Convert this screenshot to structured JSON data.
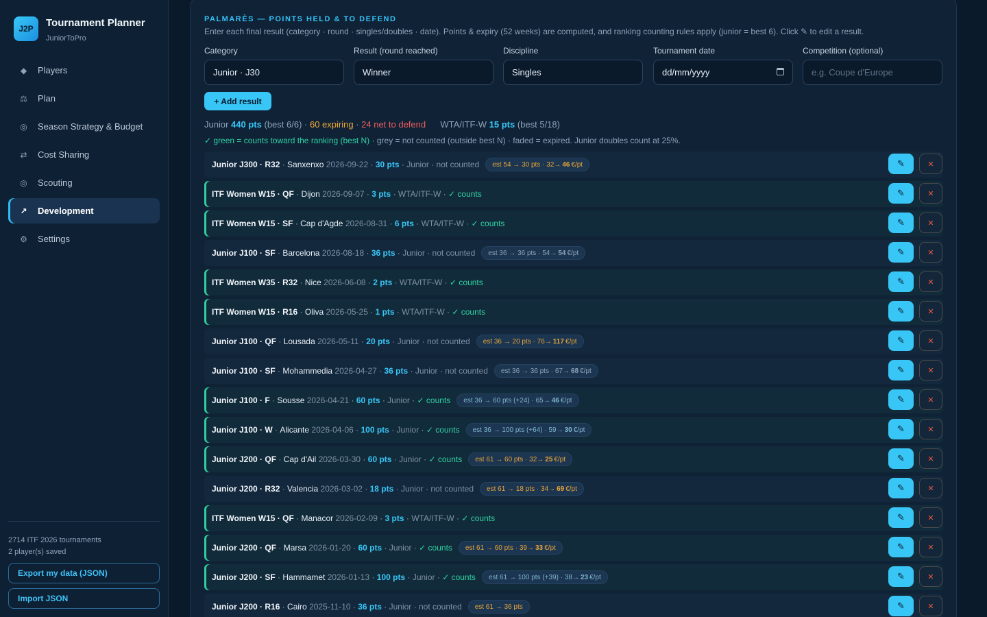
{
  "app": {
    "logo": "J2P",
    "title": "Tournament Planner",
    "subtitle": "JuniorToPro"
  },
  "nav": [
    {
      "icon": "◆",
      "icon_name": "diamond-icon",
      "label": "Players"
    },
    {
      "icon": "⚖",
      "icon_name": "scale-icon",
      "label": "Plan"
    },
    {
      "icon": "◎",
      "icon_name": "target-icon",
      "label": "Season Strategy & Budget"
    },
    {
      "icon": "⇄",
      "icon_name": "swap-arrows-icon",
      "label": "Cost Sharing"
    },
    {
      "icon": "◎",
      "icon_name": "target-icon",
      "label": "Scouting"
    },
    {
      "icon": "↗",
      "icon_name": "trend-arrow-icon",
      "label": "Development",
      "active": true
    },
    {
      "icon": "⚙",
      "icon_name": "gear-icon",
      "label": "Settings"
    }
  ],
  "sidebar_footer": {
    "stats_line1": "2714 ITF 2026 tournaments",
    "stats_line2": "2 player(s) saved",
    "export_label": "Export my data (JSON)",
    "import_label": "Import JSON"
  },
  "palmares": {
    "title": "PALMARÈS — POINTS HELD & TO DEFEND",
    "description": "Enter each final result (category · round · singles/doubles · date). Points & expiry (52 weeks) are computed, and ranking counting rules apply (junior = best 6). Click ✎ to edit a result.",
    "form": {
      "category_label": "Category",
      "category_value": "Junior · J30",
      "result_label": "Result (round reached)",
      "result_value": "Winner",
      "discipline_label": "Discipline",
      "discipline_value": "Singles",
      "date_label": "Tournament date",
      "date_placeholder": "dd/mm/yyyy",
      "competition_label": "Competition (optional)",
      "competition_placeholder": "e.g. Coupe d'Europe"
    },
    "add_button": "+ Add result",
    "summary": {
      "junior_prefix": "Junior",
      "junior_pts": "440 pts",
      "junior_best": "(best 6/6)",
      "expiring": "60 expiring",
      "net_defend": "24 net to defend",
      "wta_prefix": "WTA/ITF-W",
      "wta_pts": "15 pts",
      "wta_best": "(best 5/18)"
    },
    "legend": {
      "green": "✓ green = counts toward the ranking (best N)",
      "rest": "· grey = not counted (outside best N) · faded = expired. Junior doubles count at 25%."
    }
  },
  "results": [
    {
      "title": "Junior J300 · R32",
      "venue": "Sanxenxo",
      "date": "2026-09-22",
      "pts": "30 pts",
      "circuit": "Junior",
      "status": "not counted",
      "counts": false,
      "est_a": "est 54 → 30 pts · 32→",
      "est_b": "46",
      "est_c": "€/pt",
      "est_tone": "warn"
    },
    {
      "title": "ITF Women W15 · QF",
      "venue": "Dijon",
      "date": "2026-09-07",
      "pts": "3 pts",
      "circuit": "WTA/ITF-W",
      "status": "✓ counts",
      "counts": true
    },
    {
      "title": "ITF Women W15 · SF",
      "venue": "Cap d'Agde",
      "date": "2026-08-31",
      "pts": "6 pts",
      "circuit": "WTA/ITF-W",
      "status": "✓ counts",
      "counts": true
    },
    {
      "title": "Junior J100 · SF",
      "venue": "Barcelona",
      "date": "2026-08-18",
      "pts": "36 pts",
      "circuit": "Junior",
      "status": "not counted",
      "counts": false,
      "est_a": "est 36 → 36 pts · 54→",
      "est_b": "54",
      "est_c": "€/pt",
      "est_tone": ""
    },
    {
      "title": "ITF Women W35 · R32",
      "venue": "Nice",
      "date": "2026-06-08",
      "pts": "2 pts",
      "circuit": "WTA/ITF-W",
      "status": "✓ counts",
      "counts": true
    },
    {
      "title": "ITF Women W15 · R16",
      "venue": "Oliva",
      "date": "2026-05-25",
      "pts": "1 pts",
      "circuit": "WTA/ITF-W",
      "status": "✓ counts",
      "counts": true
    },
    {
      "title": "Junior J100 · QF",
      "venue": "Lousada",
      "date": "2026-05-11",
      "pts": "20 pts",
      "circuit": "Junior",
      "status": "not counted",
      "counts": false,
      "est_a": "est 36 → 20 pts · 76→",
      "est_b": "117",
      "est_c": "€/pt",
      "est_tone": "warn"
    },
    {
      "title": "Junior J100 · SF",
      "venue": "Mohammedia",
      "date": "2026-04-27",
      "pts": "36 pts",
      "circuit": "Junior",
      "status": "not counted",
      "counts": false,
      "est_a": "est 36 → 36 pts · 67→",
      "est_b": "68",
      "est_c": "€/pt",
      "est_tone": ""
    },
    {
      "title": "Junior J100 · F",
      "venue": "Sousse",
      "date": "2026-04-21",
      "pts": "60 pts",
      "circuit": "Junior",
      "status": "✓ counts",
      "counts": true,
      "est_a": "est 36 → 60 pts (+24) · 65→",
      "est_b": "46",
      "est_c": "€/pt",
      "est_tone": "ok2"
    },
    {
      "title": "Junior J100 · W",
      "venue": "Alicante",
      "date": "2026-04-06",
      "pts": "100 pts",
      "circuit": "Junior",
      "status": "✓ counts",
      "counts": true,
      "est_a": "est 36 → 100 pts (+64) · 59→",
      "est_b": "30",
      "est_c": "€/pt",
      "est_tone": "ok2"
    },
    {
      "title": "Junior J200 · QF",
      "venue": "Cap d'Ail",
      "date": "2026-03-30",
      "pts": "60 pts",
      "circuit": "Junior",
      "status": "✓ counts",
      "counts": true,
      "est_a": "est 61 → 60 pts · 32→",
      "est_b": "25",
      "est_c": "€/pt",
      "est_tone": "warn"
    },
    {
      "title": "Junior J200 · R32",
      "venue": "Valencia",
      "date": "2026-03-02",
      "pts": "18 pts",
      "circuit": "Junior",
      "status": "not counted",
      "counts": false,
      "est_a": "est 61 → 18 pts · 34→",
      "est_b": "69",
      "est_c": "€/pt",
      "est_tone": "warn"
    },
    {
      "title": "ITF Women W15 · QF",
      "venue": "Manacor",
      "date": "2026-02-09",
      "pts": "3 pts",
      "circuit": "WTA/ITF-W",
      "status": "✓ counts",
      "counts": true
    },
    {
      "title": "Junior J200 · QF",
      "venue": "Marsa",
      "date": "2026-01-20",
      "pts": "60 pts",
      "circuit": "Junior",
      "status": "✓ counts",
      "counts": true,
      "est_a": "est 61 → 60 pts · 39→",
      "est_b": "33",
      "est_c": "€/pt",
      "est_tone": "warn"
    },
    {
      "title": "Junior J200 · SF",
      "venue": "Hammamet",
      "date": "2026-01-13",
      "pts": "100 pts",
      "circuit": "Junior",
      "status": "✓ counts",
      "counts": true,
      "est_a": "est 61 → 100 pts (+39) · 38→",
      "est_b": "23",
      "est_c": "€/pt",
      "est_tone": "ok2"
    },
    {
      "title": "Junior J200 · R16",
      "venue": "Cairo",
      "date": "2025-11-10",
      "pts": "36 pts",
      "circuit": "Junior",
      "status": "not counted",
      "counts": false,
      "est_a": "est 61 → 36 pts",
      "est_b": "",
      "est_c": "",
      "est_tone": "warn"
    }
  ],
  "icons": {
    "edit": "✎",
    "delete": "✕"
  },
  "colors": {
    "accent": "#38c6f6",
    "counts_green": "#2fd3a3",
    "expiring_orange": "#f0a93a",
    "defend_red": "#f05e5e",
    "background": "#0b1a2b"
  }
}
